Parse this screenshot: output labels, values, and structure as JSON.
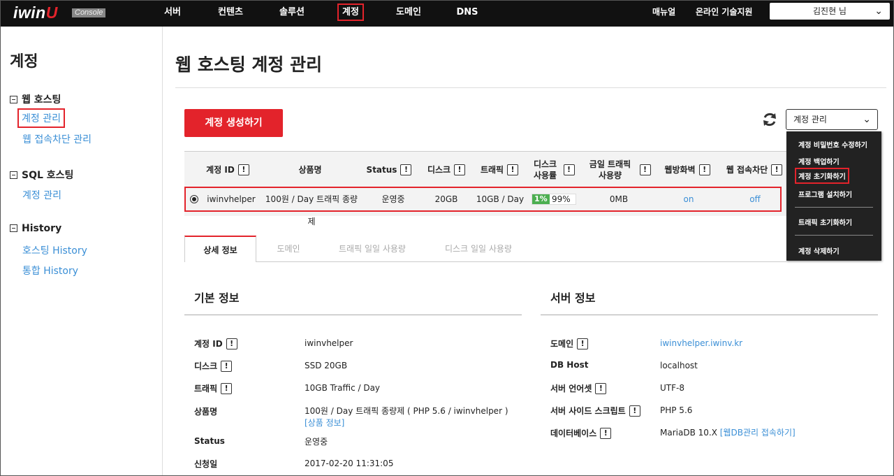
{
  "nav": {
    "logo_text": "iwin",
    "logo_u": "U",
    "console_badge": "Console",
    "items": [
      "서버",
      "컨텐츠",
      "솔루션",
      "계정",
      "도메인",
      "DNS"
    ],
    "manual": "매뉴얼",
    "support": "온라인 기술지원",
    "user": "김진현 님"
  },
  "sidebar": {
    "title": "계정",
    "groups": [
      {
        "label": "웹 호스팅",
        "links": [
          "계정 관리",
          "웹 접속차단 관리"
        ]
      },
      {
        "label": "SQL 호스팅",
        "links": [
          "계정 관리"
        ]
      },
      {
        "label": "History",
        "links": [
          "호스팅 History",
          "통합 History"
        ]
      }
    ]
  },
  "main": {
    "title": "웹 호스팅 계정 관리",
    "create_button": "계정 생성하기",
    "account_select": "계정 관리"
  },
  "table": {
    "headers": [
      "계정 ID",
      "상품명",
      "Status",
      "디스크",
      "트래픽",
      "디스크 사용률",
      "금일 트래픽 사용량",
      "웹방화벽",
      "웹 접속차단"
    ],
    "row": {
      "id": "iwinvhelper",
      "product": "100원 / Day 트래픽 종량제",
      "status": "운영중",
      "disk": "20GB",
      "traffic": "10GB / Day",
      "disk_usage_fill": "1%",
      "disk_usage_free": "99%",
      "today_traffic": "0MB",
      "firewall": "on",
      "block": "off"
    }
  },
  "dropdown": {
    "items": [
      "계정 비밀번호 수정하기",
      "계정 백업하기",
      "계정 초기화하기",
      "프로그램 설치하기",
      "트래픽 초기화하기",
      "계정 삭제하기"
    ]
  },
  "tabs": [
    "상세 정보",
    "도메인",
    "트래픽 일일 사용량",
    "디스크 일일 사용량"
  ],
  "basic_info": {
    "title": "기본 정보",
    "rows": [
      {
        "label": "계정 ID",
        "value": "iwinvhelper"
      },
      {
        "label": "디스크",
        "value": "SSD 20GB"
      },
      {
        "label": "트래픽",
        "value": "10GB Traffic / Day"
      },
      {
        "label": "상품명",
        "value": "100원 / Day 트래픽 종량제 ( PHP 5.6 / iwinvhelper )",
        "link": "[상품 정보]"
      },
      {
        "label": "Status",
        "value": "운영중"
      },
      {
        "label": "신청일",
        "value": "2017-02-20 11:31:05"
      }
    ]
  },
  "server_info": {
    "title": "서버 정보",
    "rows": [
      {
        "label": "도메인",
        "value": "iwinvhelper.iwinv.kr"
      },
      {
        "label": "DB Host",
        "value": "localhost"
      },
      {
        "label": "서버 언어셋",
        "value": "UTF-8"
      },
      {
        "label": "서버 사이드 스크립트",
        "value": "PHP 5.6"
      },
      {
        "label": "데이터베이스",
        "value": "MariaDB 10.X",
        "link": "[웹DB관리 접속하기]"
      }
    ]
  },
  "icons": {
    "refresh": "refresh-icon",
    "chevron": "chevron-down-icon",
    "info": "exclamation-icon"
  },
  "colors": {
    "accent": "#e3232b",
    "link": "#3b8fd6",
    "nav_bg": "#111111",
    "usage": "#4caf50"
  }
}
